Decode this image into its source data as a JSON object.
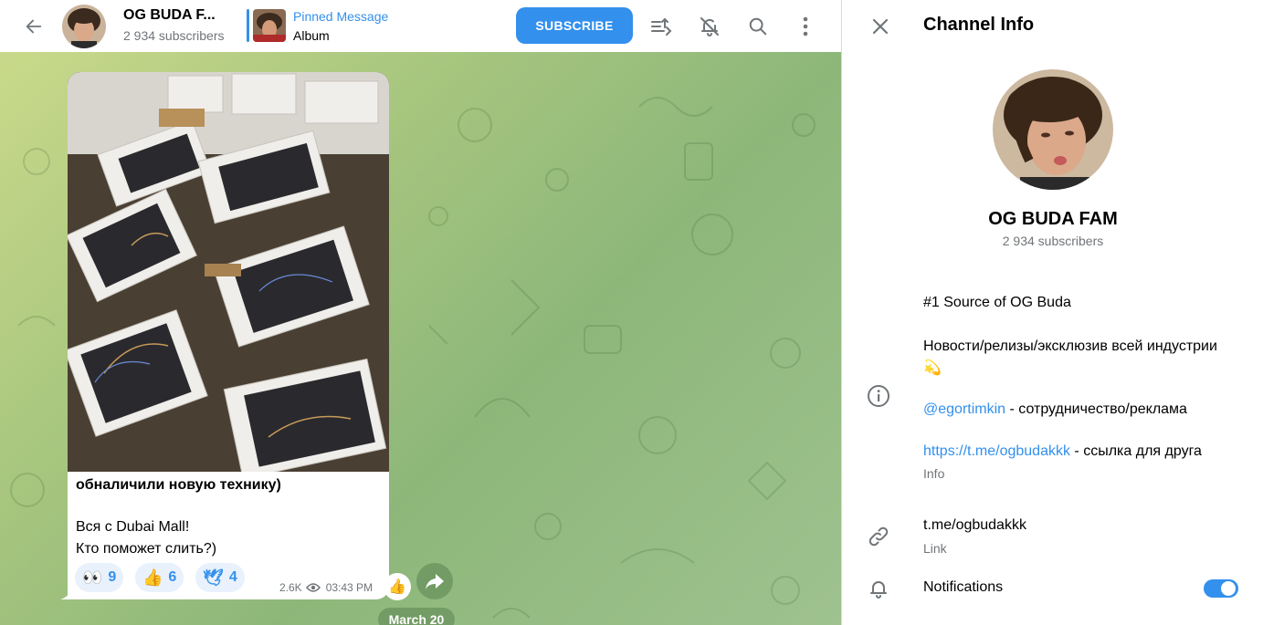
{
  "header": {
    "channel_title": "OG BUDA F...",
    "subscribers": "2 934 subscribers",
    "pinned_title": "Pinned Message",
    "pinned_text": "Album",
    "subscribe_label": "SUBSCRIBE"
  },
  "message": {
    "line1": "обналичили новую технику)",
    "line2": "Вся с Dubai Mall!",
    "line3": "Кто поможет слить?)",
    "reactions": [
      {
        "emoji": "👀",
        "count": "9"
      },
      {
        "emoji": "👍",
        "count": "6"
      },
      {
        "emoji": "🕊",
        "count": "4"
      }
    ],
    "views": "2.6K",
    "time": "03:43 PM",
    "side_reaction": "👍"
  },
  "date_separator": "March 20",
  "panel": {
    "title": "Channel Info",
    "name": "OG BUDA FAM",
    "subscribers": "2 934 subscribers",
    "description": {
      "line1": "#1 Source of OG Buda",
      "line2": "Новости/релизы/эксклюзив всей индустрии 💫",
      "mention": "@egortimkin",
      "mention_suffix": " - сотрудничество/реклама",
      "url": "https://t.me/ogbudakkk",
      "url_suffix": " -  ссылка для друга"
    },
    "info_caption": "Info",
    "link_value": "t.me/ogbudakkk",
    "link_caption": "Link",
    "notifications_label": "Notifications",
    "notifications_on": true
  },
  "colors": {
    "accent": "#3390ec",
    "secondary_text": "#707579"
  },
  "icons": [
    "back-arrow-icon",
    "filter-icon",
    "bell-off-icon",
    "search-icon",
    "more-vertical-icon",
    "close-icon",
    "info-icon",
    "link-icon",
    "bell-icon",
    "eye-icon",
    "share-icon"
  ]
}
